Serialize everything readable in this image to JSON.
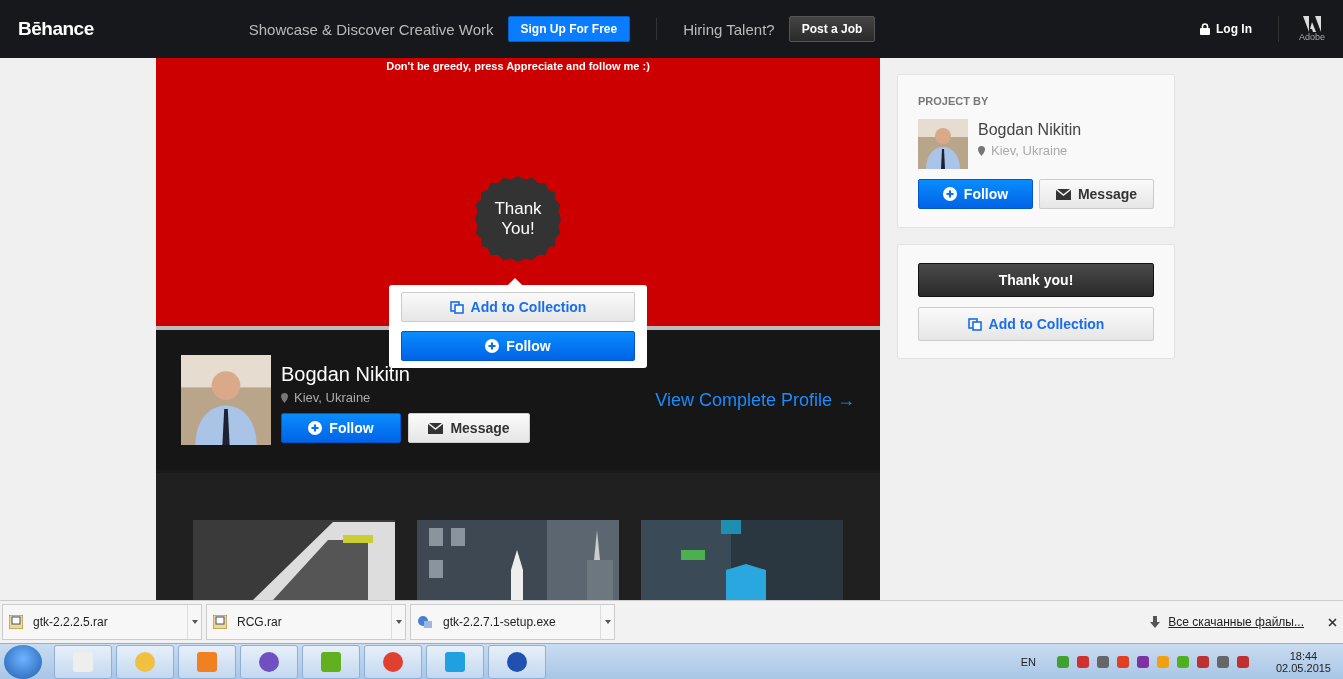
{
  "nav": {
    "logo": "Bēhance",
    "tagline": "Showcase & Discover Creative Work",
    "signup": "Sign Up For Free",
    "hiring": "Hiring Talent?",
    "post_job": "Post a Job",
    "login": "Log In",
    "adobe": "Adobe"
  },
  "project": {
    "note": "Don't be greedy, press Appreciate and follow me :)",
    "badge": "Thank You!",
    "popup": {
      "collection": "Add to Collection",
      "follow": "Follow"
    }
  },
  "profile": {
    "name": "Bogdan Nikitin",
    "location": "Kiev, Ukraine",
    "follow": "Follow",
    "message": "Message",
    "view_profile": "View Complete Profile →"
  },
  "sidebar": {
    "heading": "PROJECT BY",
    "name": "Bogdan Nikitin",
    "location": "Kiev, Ukraine",
    "follow": "Follow",
    "message": "Message",
    "thank_you": "Thank you!",
    "collection": "Add to Collection"
  },
  "downloads": {
    "files": [
      {
        "name": "gtk-2.2.2.5.rar",
        "kind": "archive"
      },
      {
        "name": "RCG.rar",
        "kind": "archive"
      },
      {
        "name": "gtk-2.2.7.1-setup.exe",
        "kind": "setup"
      }
    ],
    "show_all": "Все скачанные файлы..."
  },
  "taskbar": {
    "language": "EN",
    "time": "18:44",
    "date": "02.05.2015"
  }
}
